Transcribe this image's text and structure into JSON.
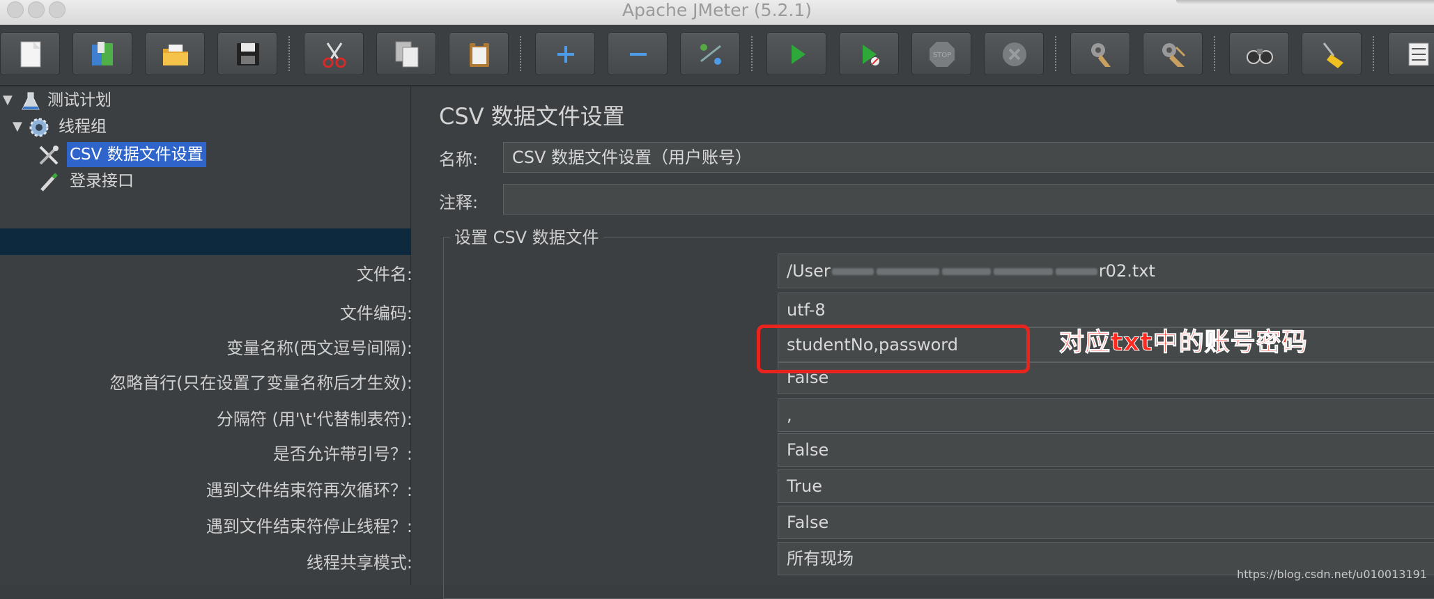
{
  "window": {
    "title": "Apache JMeter (5.2.1)"
  },
  "toolbar": {
    "buttons": [
      {
        "name": "new",
        "icon": "new-document-icon"
      },
      {
        "name": "templates",
        "icon": "templates-icon"
      },
      {
        "name": "open",
        "icon": "open-folder-icon"
      },
      {
        "name": "save",
        "icon": "save-disk-icon"
      },
      {
        "name": "cut",
        "icon": "scissors-icon"
      },
      {
        "name": "copy",
        "icon": "copy-icon"
      },
      {
        "name": "paste",
        "icon": "clipboard-icon"
      },
      {
        "name": "expand",
        "icon": "plus-icon"
      },
      {
        "name": "collapse",
        "icon": "minus-icon"
      },
      {
        "name": "toggle",
        "icon": "toggle-icon"
      },
      {
        "name": "start",
        "icon": "play-icon"
      },
      {
        "name": "start-no-pauses",
        "icon": "play-no-timer-icon"
      },
      {
        "name": "stop",
        "icon": "stop-sign-icon"
      },
      {
        "name": "shutdown",
        "icon": "shutdown-x-icon"
      },
      {
        "name": "clear",
        "icon": "broom-gear-icon"
      },
      {
        "name": "clear-all",
        "icon": "broom-gear-all-icon"
      },
      {
        "name": "search",
        "icon": "binoculars-icon"
      },
      {
        "name": "reset-search",
        "icon": "broom-icon"
      },
      {
        "name": "function-helper",
        "icon": "list-icon"
      }
    ]
  },
  "tree": {
    "items": [
      {
        "label": "测试计划",
        "icon": "flask-icon"
      },
      {
        "label": "线程组",
        "icon": "gear-icon"
      },
      {
        "label": "CSV 数据文件设置",
        "icon": "tools-icon",
        "selected": true
      },
      {
        "label": "登录接口",
        "icon": "pen-icon"
      }
    ]
  },
  "panel": {
    "title": "CSV 数据文件设置",
    "name_label": "名称:",
    "name_value": "CSV 数据文件设置（用户账号）",
    "comment_label": "注释:",
    "comment_value": "",
    "group_title": "设置 CSV 数据文件",
    "fields": [
      {
        "label": "文件名:",
        "value_prefix": "/User",
        "value_suffix": "r02.txt"
      },
      {
        "label": "文件编码:",
        "value": "utf-8"
      },
      {
        "label": "变量名称(西文逗号间隔):",
        "value": "studentNo,password"
      },
      {
        "label": "忽略首行(只在设置了变量名称后才生效):",
        "value": "False"
      },
      {
        "label": "分隔符 (用'\\t'代替制表符):",
        "value": ","
      },
      {
        "label": "是否允许带引号？:",
        "value": "False"
      },
      {
        "label": "遇到文件结束符再次循环？:",
        "value": "True"
      },
      {
        "label": "遇到文件结束符停止线程？:",
        "value": "False"
      },
      {
        "label": "线程共享模式:",
        "value": "所有现场"
      }
    ]
  },
  "annotation": {
    "text": "对应txt中的账号密码",
    "color": "#e8241e"
  },
  "watermark": "https://blog.csdn.net/u010013191",
  "colors": {
    "selection": "#2f65ca",
    "background": "#3c3f41",
    "accent_red": "#e8241e"
  }
}
